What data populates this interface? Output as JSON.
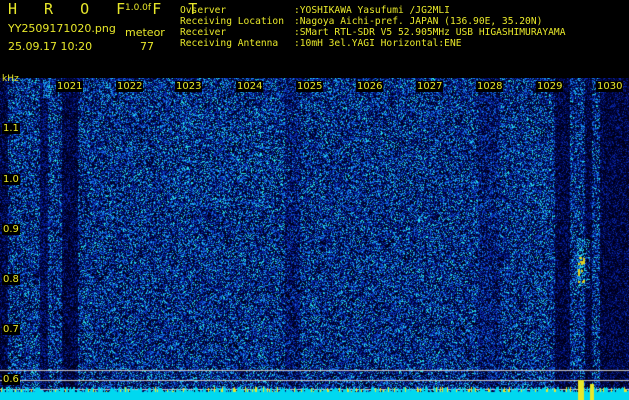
{
  "header": {
    "app": "H R O F F T",
    "version": "1.0.0f",
    "file": "YY2509171020.png",
    "meteor_label": "meteor",
    "timestamp": "25.09.17 10:20",
    "count": "77"
  },
  "info": [
    {
      "key": "Ovserver",
      "value": ":YOSHIKAWA Yasufumi /JG2MLI"
    },
    {
      "key": "Receiving Location",
      "value": ":Nagoya Aichi-pref. JAPAN (136.90E, 35.20N)"
    },
    {
      "key": "Receiver",
      "value": ":SMart RTL-SDR V5 52.905MHz USB HIGASHIMURAYAMA"
    },
    {
      "key": "Receiving Antenna",
      "value": ":10mH 3el.YAGI Horizontal:ENE"
    }
  ],
  "y_axis": {
    "unit": "kHz",
    "ticks": [
      "1.1",
      "1.0",
      "0.9",
      "0.8",
      "0.7",
      "0.6"
    ]
  },
  "x_axis": {
    "ticks": [
      "1021",
      "1022",
      "1023",
      "1024",
      "1025",
      "1026",
      "1027",
      "1028",
      "1029",
      "1030"
    ]
  },
  "colors": {
    "label": "#e8e82a",
    "background": "#000000",
    "noise_low": "#001a6a",
    "noise_high": "#00e0ff"
  }
}
